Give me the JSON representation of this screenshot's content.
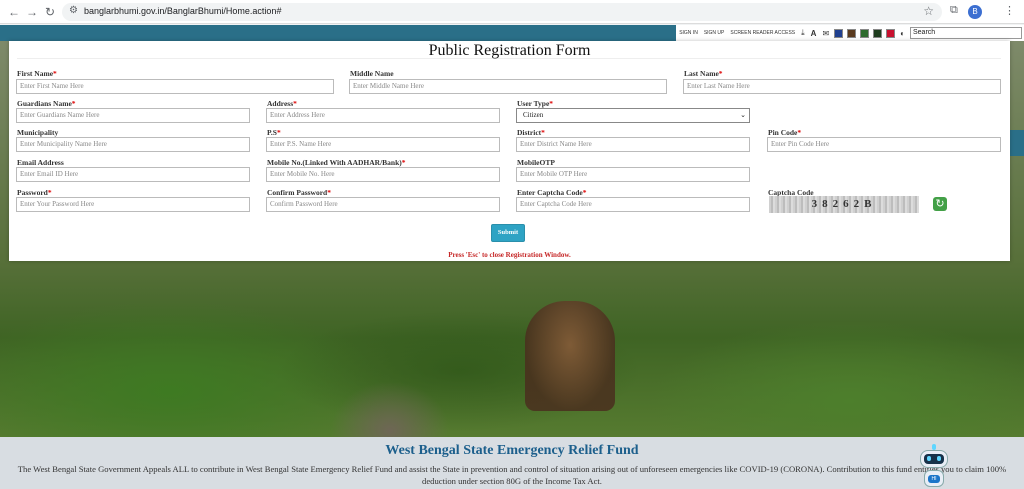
{
  "browser": {
    "url": "banglarbhumi.gov.in/BanglarBhumi/Home.action#",
    "profile_initial": "B"
  },
  "site_tools": {
    "sign_in": "SIGN IN",
    "sign_up": "SIGN UP",
    "screen_reader": "SCREEN READER ACCESS",
    "search_value": "Search",
    "swatches": [
      "#1f3f8f",
      "#5a3a1e",
      "#2e6b2e",
      "#1e3d1e",
      "#c8102e",
      "#444444"
    ]
  },
  "modal": {
    "title": "Public Registration Form",
    "fields": {
      "first_name": {
        "label": "First Name",
        "placeholder": "Enter First Name Here"
      },
      "middle_name": {
        "label": "Middle Name",
        "placeholder": "Enter Middle Name Here"
      },
      "last_name": {
        "label": "Last Name",
        "placeholder": "Enter Last Name Here"
      },
      "guardian_name": {
        "label": "Guardians Name",
        "placeholder": "Enter Guardians Name Here"
      },
      "address": {
        "label": "Address",
        "placeholder": "Enter Address Here"
      },
      "user_type": {
        "label": "User Type",
        "value": "Citizen"
      },
      "municipality": {
        "label": "Municipality",
        "placeholder": "Enter Municipality Name Here"
      },
      "ps": {
        "label": "P.S",
        "placeholder": "Enter P.S. Name Here"
      },
      "district": {
        "label": "District",
        "placeholder": "Enter District Name Here"
      },
      "pin_code": {
        "label": "Pin Code",
        "placeholder": "Enter Pin Code Here"
      },
      "email": {
        "label": "Email Address",
        "placeholder": "Enter Email ID Here"
      },
      "mobile": {
        "label": "Mobile No.(Linked With AADHAR/Bank)",
        "placeholder": "Enter Mobile No. Here"
      },
      "mobile_otp": {
        "label": "MobileOTP",
        "placeholder": "Enter Mobile OTP Here"
      },
      "password": {
        "label": "Password",
        "placeholder": "Enter Your Password Here"
      },
      "confirm_password": {
        "label": "Confirm Password",
        "placeholder": "Confirm Password Here"
      },
      "captcha_input": {
        "label": "Enter Captcha Code",
        "placeholder": "Enter Captcha Code Here"
      },
      "captcha": {
        "label": "Captcha Code",
        "value": "38262B"
      }
    },
    "required_mark": "*",
    "submit_label": "Submit",
    "esc_note": "Press 'Esc' to close Registration Window."
  },
  "footer": {
    "title": "West Bengal State Emergency Relief Fund",
    "text": "The West Bengal State Government Appeals ALL to contribute in West Bengal State Emergency Relief Fund and assist the State in prevention and control of situation arising out of unforeseen emergencies like COVID-19 (CORONA). Contribution to this fund entitles you to claim 100% deduction under section 80G of the Income Tax Act."
  },
  "chat_bot": {
    "badge": "HI"
  }
}
